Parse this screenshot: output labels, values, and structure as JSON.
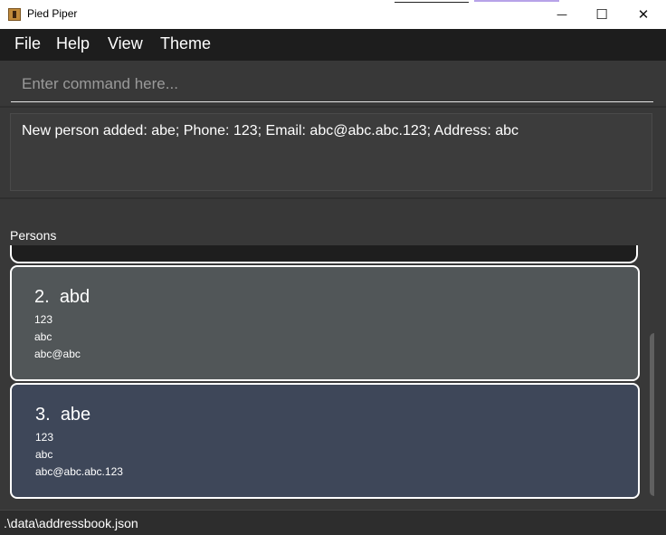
{
  "window": {
    "title": "Pied Piper",
    "controls": {
      "minimize": "—",
      "maximize": "☐",
      "close": "✕"
    }
  },
  "menu": {
    "items": [
      "File",
      "Help",
      "View",
      "Theme"
    ]
  },
  "command": {
    "placeholder": "Enter command here...",
    "value": ""
  },
  "result": {
    "message": "New person added: abe; Phone: 123; Email: abc@abc.abc.123; Address: abc"
  },
  "person_list": {
    "label": "Persons",
    "cards": [
      {
        "index": "2.",
        "name": "abd",
        "phone": "123",
        "address": "abc",
        "email": "abc@abc",
        "color": "#515658"
      },
      {
        "index": "3.",
        "name": "abe",
        "phone": "123",
        "address": "abc",
        "email": "abc@abc.abc.123",
        "color": "#3e4759"
      }
    ]
  },
  "status": {
    "file_path": ".\\data\\addressbook.json"
  }
}
